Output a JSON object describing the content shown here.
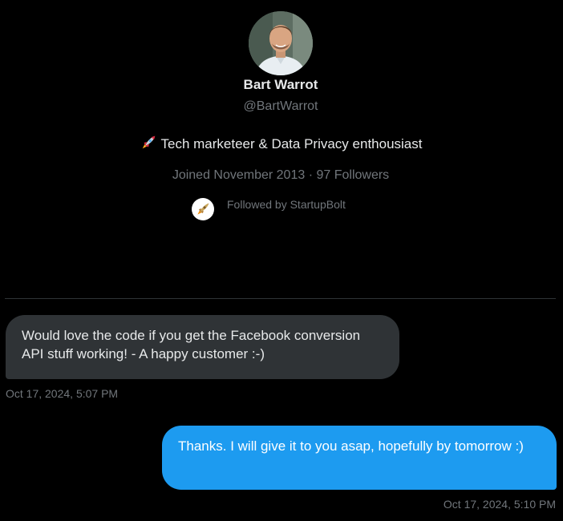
{
  "profile": {
    "avatar_icon": "user-avatar-photo",
    "display_name": "Bart Warrot",
    "handle": "@BartWarrot",
    "bio_icon": "rocket-emoji",
    "bio": "Tech marketeer & Data Privacy enthousiast",
    "joined_and_followers": "Joined November 2013 · 97 Followers",
    "followed_by": "Followed by StartupBolt",
    "followed_by_avatar_icon": "rocket-logo"
  },
  "messages": [
    {
      "direction": "received",
      "text": "Would love the code if you get the Facebook conversion API stuff working! - A happy customer :-)",
      "timestamp": "Oct 17, 2024, 5:07 PM"
    },
    {
      "direction": "sent",
      "text": "Thanks. I will give it to you asap, hopefully by tomorrow :)",
      "timestamp": "Oct 17, 2024, 5:10 PM"
    }
  ],
  "colors": {
    "background": "#000000",
    "received_bubble": "#2f3336",
    "sent_bubble": "#1d9bf0",
    "primary_text": "#e7e9ea",
    "secondary_text": "#71767b",
    "divider": "#2f3336"
  }
}
